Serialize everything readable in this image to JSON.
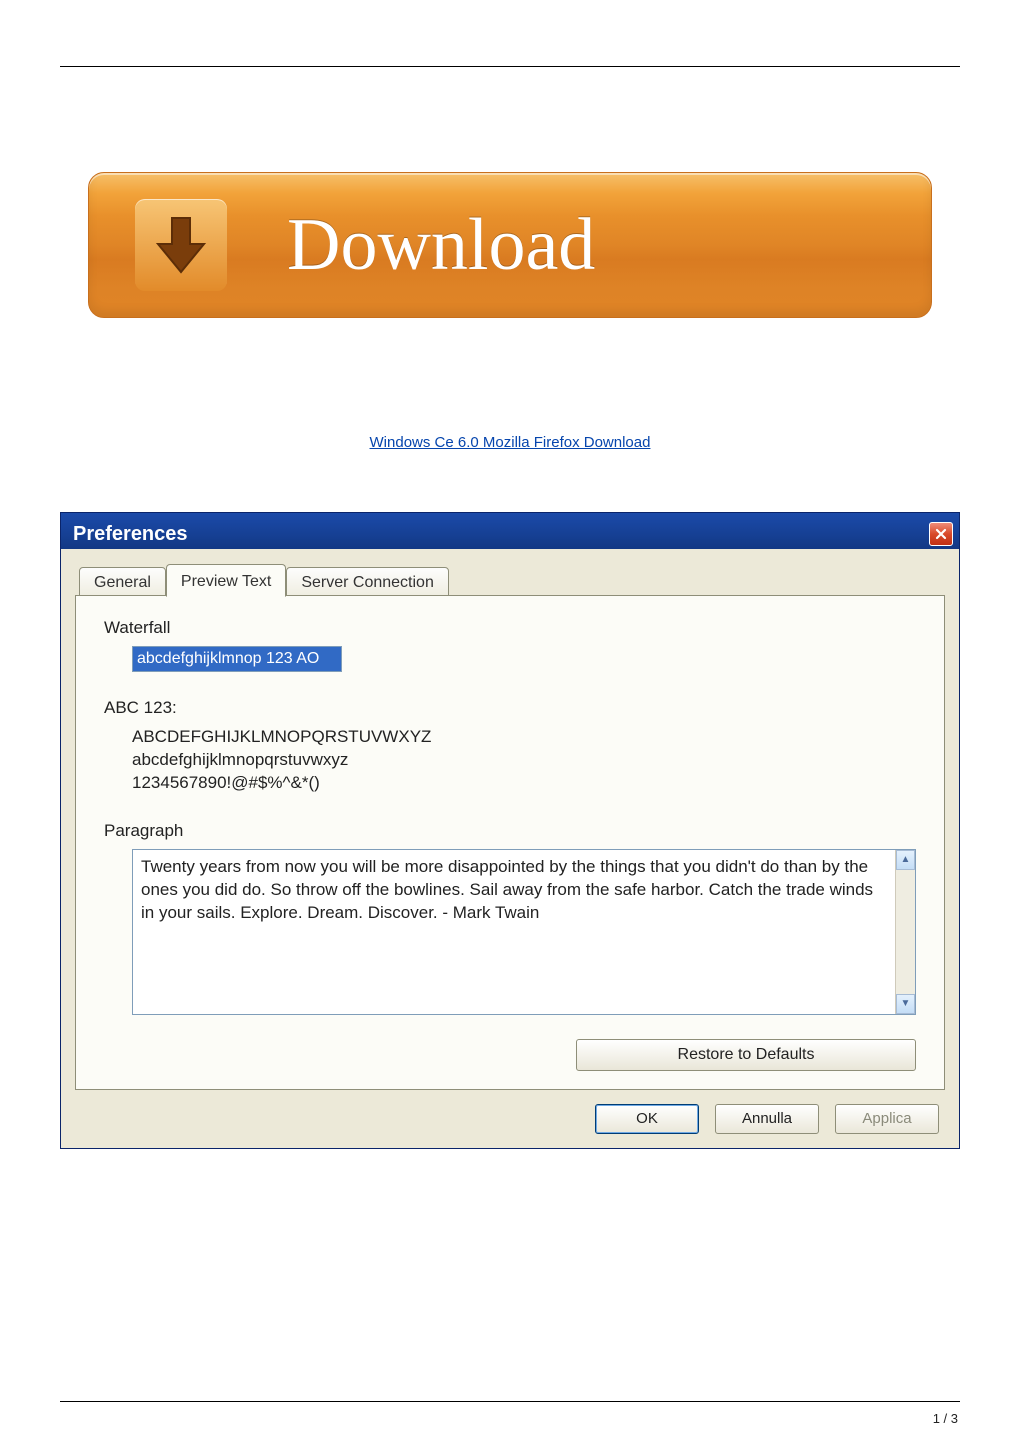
{
  "download_button": {
    "label": "Download",
    "icon": "download-arrow-icon"
  },
  "page_link": {
    "text": "Windows Ce 6.0 Mozilla Firefox Download"
  },
  "dialog": {
    "title": "Preferences",
    "close_icon": "close-icon",
    "tabs": [
      {
        "label": "General",
        "selected": false
      },
      {
        "label": "Preview Text",
        "selected": true
      },
      {
        "label": "Server Connection",
        "selected": false
      }
    ],
    "fields": {
      "waterfall": {
        "label": "Waterfall",
        "value": "abcdefghijklmnop 123 AO"
      },
      "abc123": {
        "label": "ABC 123:",
        "lines": [
          "ABCDEFGHIJKLMNOPQRSTUVWXYZ",
          "abcdefghijklmnopqrstuvwxyz",
          "1234567890!@#$%^&*()"
        ]
      },
      "paragraph": {
        "label": "Paragraph",
        "value": "Twenty years from now you will be more disappointed by the things that you didn't do than by the ones you did do. So throw off the bowlines. Sail away from the safe harbor. Catch the trade winds in your sails. Explore. Dream. Discover. - Mark Twain"
      }
    },
    "buttons": {
      "restore": "Restore to Defaults",
      "ok": "OK",
      "cancel": "Annulla",
      "apply": "Applica"
    }
  },
  "footer": {
    "page_number": "1 / 3"
  }
}
